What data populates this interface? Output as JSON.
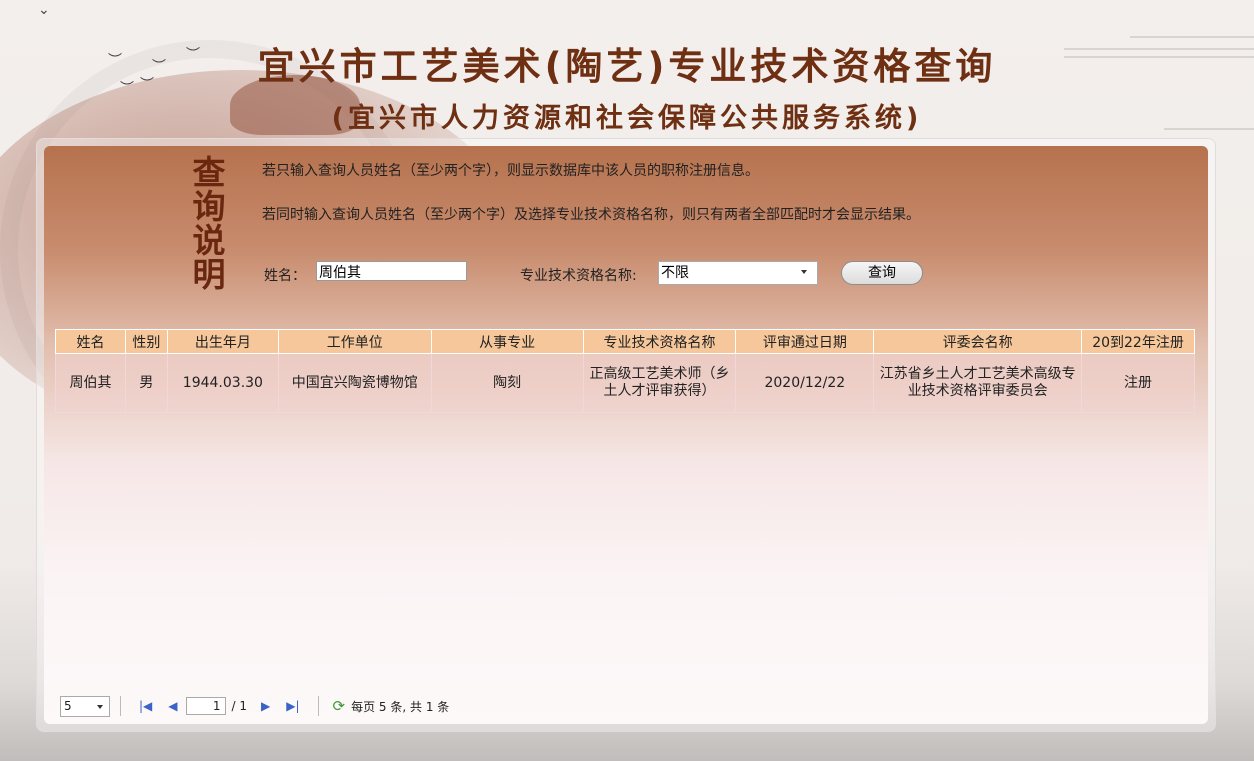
{
  "header": {
    "title": "宜兴市工艺美术(陶艺)专业技术资格查询",
    "subtitle": "(宜兴市人力资源和社会保障公共服务系统)"
  },
  "instructions": {
    "glyph": [
      "查",
      "询",
      "说",
      "明"
    ],
    "line1": "若只输入查询人员姓名（至少两个字），则显示数据库中该人员的职称注册信息。",
    "line2": "若同时输入查询人员姓名（至少两个字）及选择专业技术资格名称，则只有两者全部匹配时才会显示结果。"
  },
  "form": {
    "name_label": "姓名：",
    "name_value": "周伯其",
    "qual_label": "专业技术资格名称:",
    "qual_value": "不限",
    "query_button": "查询"
  },
  "table": {
    "columns": [
      "姓名",
      "性别",
      "出生年月",
      "工作单位",
      "从事专业",
      "专业技术资格名称",
      "评审通过日期",
      "评委会名称",
      "20到22年注册"
    ],
    "rows": [
      [
        "周伯其",
        "男",
        "1944.03.30",
        "中国宜兴陶瓷博物馆",
        "陶刻",
        "正高级工艺美术师（乡土人才评审获得）",
        "2020/12/22",
        "江苏省乡土人才工艺美术高级专业技术资格评审委员会",
        "注册"
      ]
    ]
  },
  "pager": {
    "page_size": "5",
    "current_page": "1",
    "total_pages": "/ 1",
    "summary": "每页 5 条, 共 1 条"
  },
  "colors": {
    "title": "#6e2f12",
    "header_cell": "#f5c79a",
    "panel_top": "#b6724e"
  }
}
